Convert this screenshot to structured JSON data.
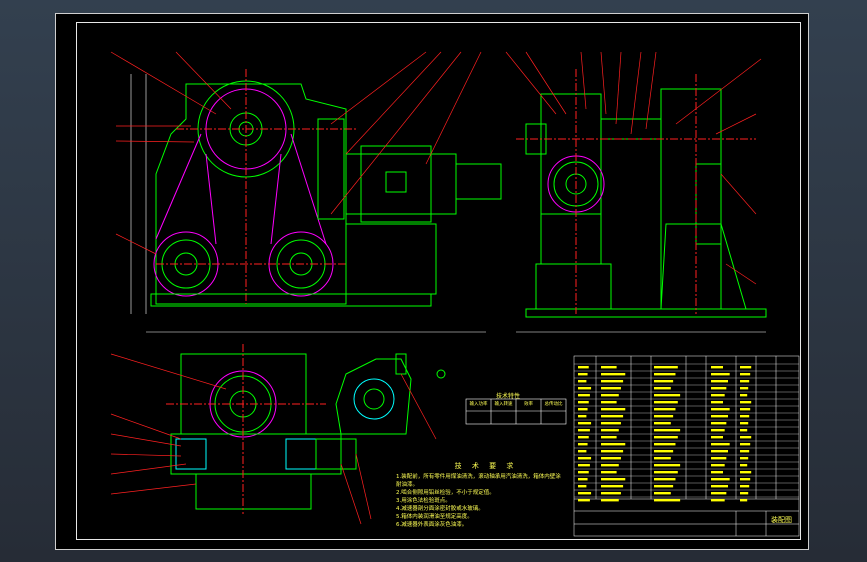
{
  "colors": {
    "background": "#000000",
    "frame": "#e8e8e8",
    "body": "#00ff00",
    "hidden": "#ff00ff",
    "dimension": "#ffffff",
    "annotation": "#ffff00",
    "leader": "#ff2020",
    "center": "#ff2020",
    "hatch": "#00ffff"
  },
  "technical_requirements": {
    "heading": "技 术 要 求",
    "lines": [
      "1.装配前，所有零件用煤油清洗，滚动轴承用汽油清洗，箱体内壁涂",
      "  耐油漆。",
      "2.啮合侧隙用铅丝检验，不小于规定值。",
      "3.用涂色法检验斑点。",
      "4.减速器剖分面涂密封胶或水玻璃。",
      "5.箱体内装润滑油至规定高度。",
      "6.减速器外表面涂灰色油漆。"
    ]
  },
  "spec_table": {
    "heading": "技术特性",
    "headers": [
      "输入功率",
      "输入转速",
      "效率",
      "总传动比"
    ],
    "values": [
      "",
      "",
      "",
      ""
    ]
  },
  "title_block": {
    "drawing_name": "装配图",
    "scale": "",
    "sheet": ""
  }
}
